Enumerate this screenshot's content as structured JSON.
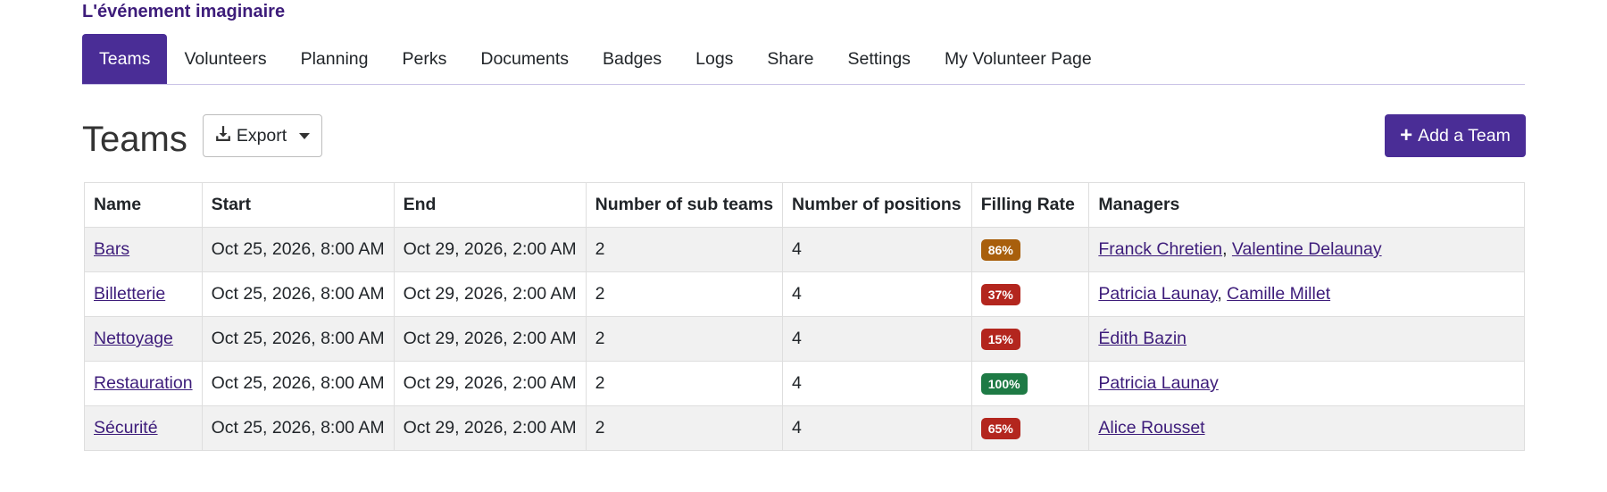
{
  "event_title": "L'événement imaginaire",
  "nav_tabs": [
    {
      "label": "Teams",
      "active": true
    },
    {
      "label": "Volunteers"
    },
    {
      "label": "Planning"
    },
    {
      "label": "Perks"
    },
    {
      "label": "Documents"
    },
    {
      "label": "Badges"
    },
    {
      "label": "Logs"
    },
    {
      "label": "Share"
    },
    {
      "label": "Settings"
    },
    {
      "label": "My Volunteer Page"
    }
  ],
  "page_title": "Teams",
  "export_button": {
    "label": "Export",
    "icon": "download-icon"
  },
  "add_button": {
    "label": "Add a Team",
    "icon": "plus-icon"
  },
  "colors": {
    "accent": "#4a2d96",
    "link": "#3d1c7a",
    "badge_warning": "#a85f0c",
    "badge_danger": "#b3261e",
    "badge_success": "#1e7a45"
  },
  "table": {
    "headers": [
      "Name",
      "Start",
      "End",
      "Number of sub teams",
      "Number of positions",
      "Filling Rate",
      "Managers"
    ],
    "rows": [
      {
        "name": "Bars",
        "start": "Oct 25, 2026, 8:00 AM",
        "end": "Oct 29, 2026, 2:00 AM",
        "sub_teams": "2",
        "positions": "4",
        "filling_rate": "86%",
        "badge_color": "#a85f0c",
        "managers": [
          "Franck Chretien",
          "Valentine Delaunay"
        ]
      },
      {
        "name": "Billetterie",
        "start": "Oct 25, 2026, 8:00 AM",
        "end": "Oct 29, 2026, 2:00 AM",
        "sub_teams": "2",
        "positions": "4",
        "filling_rate": "37%",
        "badge_color": "#b3261e",
        "managers": [
          "Patricia Launay",
          "Camille Millet"
        ]
      },
      {
        "name": "Nettoyage",
        "start": "Oct 25, 2026, 8:00 AM",
        "end": "Oct 29, 2026, 2:00 AM",
        "sub_teams": "2",
        "positions": "4",
        "filling_rate": "15%",
        "badge_color": "#b3261e",
        "managers": [
          "Édith Bazin"
        ]
      },
      {
        "name": "Restauration",
        "start": "Oct 25, 2026, 8:00 AM",
        "end": "Oct 29, 2026, 2:00 AM",
        "sub_teams": "2",
        "positions": "4",
        "filling_rate": "100%",
        "badge_color": "#1e7a45",
        "managers": [
          "Patricia Launay"
        ]
      },
      {
        "name": "Sécurité",
        "start": "Oct 25, 2026, 8:00 AM",
        "end": "Oct 29, 2026, 2:00 AM",
        "sub_teams": "2",
        "positions": "4",
        "filling_rate": "65%",
        "badge_color": "#b3261e",
        "managers": [
          "Alice Rousset"
        ]
      }
    ]
  }
}
